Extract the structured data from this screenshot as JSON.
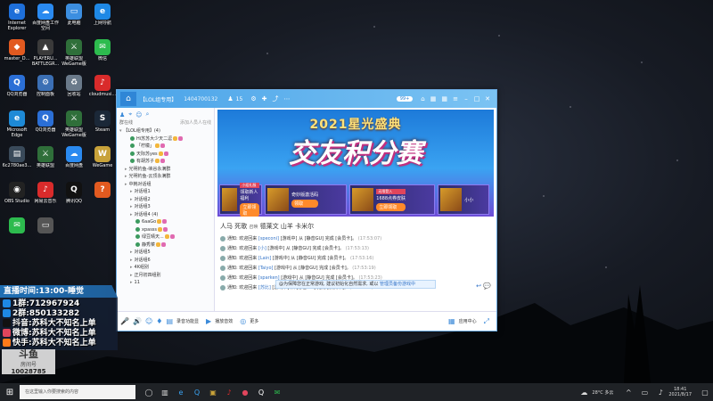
{
  "desktop": {
    "icons": [
      {
        "label": "Internet Explorer",
        "color": "#1e6fd9",
        "glyph": "e"
      },
      {
        "label": "百度网盘工作空间",
        "color": "#2a8af0",
        "glyph": "☁"
      },
      {
        "label": "此电脑",
        "color": "#3c8ee0",
        "glyph": "▭"
      },
      {
        "label": "上网导航",
        "color": "#1e88e5",
        "glyph": "e"
      },
      {
        "label": "master_D...",
        "color": "#e25a20",
        "glyph": "◆"
      },
      {
        "label": "PLAYERU... BATTLEGR...",
        "color": "#3a3a3a",
        "glyph": "▲"
      },
      {
        "label": "英雄联盟WeGame版",
        "color": "#2f6f3a",
        "glyph": "⚔"
      },
      {
        "label": "微信",
        "color": "#2dbb4e",
        "glyph": "✉"
      },
      {
        "label": "QQ浏览器",
        "color": "#2b6fd6",
        "glyph": "Q"
      },
      {
        "label": "控制面板",
        "color": "#3b6fb4",
        "glyph": "⚙"
      },
      {
        "label": "回收站",
        "color": "#6a7a8a",
        "glyph": "♻"
      },
      {
        "label": "cloudmusi...",
        "color": "#d92b2b",
        "glyph": "♪"
      },
      {
        "label": "Microsoft Edge",
        "color": "#1e8ad6",
        "glyph": "e"
      },
      {
        "label": "QQ浏览器",
        "color": "#2b6fd6",
        "glyph": "Q"
      },
      {
        "label": "英雄联盟WeGame版",
        "color": "#2f6f3a",
        "glyph": "⚔"
      },
      {
        "label": "Steam",
        "color": "#1b2838",
        "glyph": "S"
      },
      {
        "label": "6c2780ae3...",
        "color": "#3a4a5a",
        "glyph": "▤"
      },
      {
        "label": "英雄联盟",
        "color": "#2f6f3a",
        "glyph": "⚔"
      },
      {
        "label": "百度网盘",
        "color": "#2a8af0",
        "glyph": "☁"
      },
      {
        "label": "WeGame",
        "color": "#c8a23a",
        "glyph": "W"
      },
      {
        "label": "OBS Studio",
        "color": "#222",
        "glyph": "◉"
      },
      {
        "label": "网易云音乐",
        "color": "#d92b2b",
        "glyph": "♪"
      },
      {
        "label": "腾讯QQ",
        "color": "#111",
        "glyph": "Q"
      },
      {
        "label": "",
        "color": "#e25a20",
        "glyph": "?"
      },
      {
        "label": "",
        "color": "#2dbb4e",
        "glyph": "✉"
      },
      {
        "label": "",
        "color": "#555",
        "glyph": "▭"
      }
    ]
  },
  "qq": {
    "title": {
      "group_name": "【LOL组专用】",
      "group_id": "1404700132",
      "member_count": "15",
      "badge": "99+"
    },
    "sidebar": {
      "tab_label": "群在线",
      "add_friend": "添加人员人在线",
      "group_header": "【LOL组专用】(4)",
      "members": [
        {
          "name": "Hi苏苏大少天二逗",
          "level": 2
        },
        {
          "name": "「柠檬」",
          "level": 2
        },
        {
          "name": "天际苏yes",
          "level": 2
        },
        {
          "name": "有胡苏子",
          "level": 2
        }
      ],
      "sections": [
        {
          "label": "光明钓鱼-峡谷永满群",
          "level": 1
        },
        {
          "label": "光明钓鱼-云顶永满群",
          "level": 1
        },
        {
          "label": "中韩对话组",
          "level": 1
        },
        {
          "label": "对话组1",
          "level": 2
        },
        {
          "label": "对话组2",
          "level": 2
        },
        {
          "label": "对话组3",
          "level": 2
        },
        {
          "label": "对话组4 (4)",
          "level": 2
        }
      ],
      "sub_members": [
        {
          "name": "6aaGo",
          "level": 3
        },
        {
          "name": "xpasss",
          "level": 3
        },
        {
          "name": "绿豆晴天...",
          "level": 3
        },
        {
          "name": "静秀菜",
          "level": 3
        }
      ],
      "footer_sections": [
        {
          "label": "对话组5",
          "level": 2
        },
        {
          "label": "对话组6",
          "level": 2
        },
        {
          "label": "4K组别",
          "level": 2
        },
        {
          "label": "正月初四组别",
          "level": 2
        },
        {
          "label": "11",
          "level": 2
        }
      ]
    },
    "banner": {
      "title": "2021星光盛典",
      "main": "交友积分赛",
      "cards": [
        {
          "tag": "小组礼服",
          "title": "领取新人福利",
          "button": "立即领取"
        },
        {
          "tag": "",
          "title": "奇妙版激活码",
          "button": "领取"
        },
        {
          "tag": "无限登入",
          "title": "1688点券皮肤",
          "button": "立即领取"
        },
        {
          "tag": "",
          "title": "小小",
          "button": ""
        }
      ]
    },
    "chat_names": "人马 死歌 ",
    "chat_names_small": "召唤",
    "chat_names_2": " 德莱文 山羊 卡米尔",
    "chat_lines": [
      {
        "who": "[speconi]",
        "text": "通知: 欢迎回来",
        "tail": "[游戏中] 从 [静音GU] 完成 [会员卡]。",
        "time": "(17:53:07)"
      },
      {
        "who": "[小]",
        "text": "通知: 欢迎回来",
        "tail": "[游戏中] 从 [静音GU] 完成 [会员卡]。",
        "time": "(17:53:13)"
      },
      {
        "who": "[Lain]",
        "text": "通知: 欢迎回来",
        "tail": "[游戏中] 从 [静音GU] 完成 [会员卡]。",
        "time": "(17:53:16)"
      },
      {
        "who": "[Taiyo]",
        "text": "通知: 欢迎回来",
        "tail": "[游戏中] 从 [静音GU] 完成 [会员卡]。",
        "time": "(17:53:19)"
      },
      {
        "who": "[sparken]",
        "text": "通知: 欢迎回来",
        "tail": "[游戏中] 从 [静音GU] 完成 [会员卡]。",
        "time": "(17:53:23)"
      },
      {
        "who": "[苏比]",
        "text": "通知: 欢迎回来",
        "tail": "[游戏中] 从 [静音GU] 完成 [会员卡]。",
        "time": "(17:53:29)"
      }
    ],
    "notice": {
      "text": "@为保障您在正常游戏, 建议初始化自然需求, 或以",
      "link": "管理员备份游戏中"
    },
    "toolbar": {
      "record_label": "录音功能显",
      "play_label": "播放音效",
      "more_label": "更多",
      "app_label": "应用中心"
    }
  },
  "overlay": {
    "live_time": "直播时间:13:00-睡觉",
    "lines": [
      {
        "key": "1群:",
        "val": "712967924",
        "color": "#1e88e5"
      },
      {
        "key": "2群:",
        "val": "850133282",
        "color": "#1e88e5"
      },
      {
        "key": "抖音:",
        "val": "苏科大不知名上单",
        "color": "#111"
      },
      {
        "key": "微博:",
        "val": "苏科大不知名上单",
        "color": "#e0455c"
      },
      {
        "key": "快手:",
        "val": "苏科大不知名上单",
        "color": "#ff7a1a"
      }
    ],
    "room_logo": "斗鱼",
    "room_label": "房间号",
    "room_number": "10028785"
  },
  "taskbar": {
    "search_placeholder": "在这里输入你要搜索的内容",
    "weather": "28°C 多云",
    "time": "18:41",
    "date": "2021/8/17"
  }
}
